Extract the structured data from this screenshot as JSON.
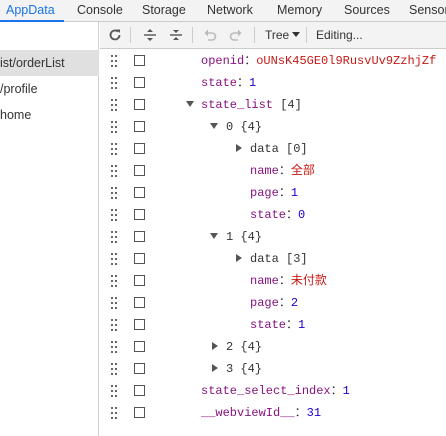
{
  "tabs": [
    "AppData",
    "Console",
    "Storage",
    "Network",
    "Memory",
    "Sources",
    "Sensor"
  ],
  "pages": [
    "ist/orderList",
    "/profile",
    "home"
  ],
  "toolbar": {
    "view_mode": "Tree",
    "editing_label": "Editing..."
  },
  "tree": {
    "openid": {
      "key": "openid",
      "value": "oUNsK45GE0l9RusvUv9ZzhjZf"
    },
    "state": {
      "key": "state",
      "value": "1"
    },
    "state_list": {
      "key": "state_list",
      "summary": "[4]"
    },
    "item0": {
      "key": "0",
      "summary": "{4}"
    },
    "item0_data": {
      "key": "data",
      "summary": "[0]"
    },
    "item0_name": {
      "key": "name",
      "value": "全部"
    },
    "item0_page": {
      "key": "page",
      "value": "1"
    },
    "item0_state": {
      "key": "state",
      "value": "0"
    },
    "item1": {
      "key": "1",
      "summary": "{4}"
    },
    "item1_data": {
      "key": "data",
      "summary": "[3]"
    },
    "item1_name": {
      "key": "name",
      "value": "未付款"
    },
    "item1_page": {
      "key": "page",
      "value": "2"
    },
    "item1_state": {
      "key": "state",
      "value": "1"
    },
    "item2": {
      "key": "2",
      "summary": "{4}"
    },
    "item3": {
      "key": "3",
      "summary": "{4}"
    },
    "state_select_index": {
      "key": "state_select_index",
      "value": "1"
    },
    "webviewId": {
      "key": "__webviewId__",
      "value": "31"
    }
  },
  "colors": {
    "accent": "#1a73e8",
    "key": "#881280",
    "number": "#1c00cf",
    "string": "#c41a16"
  },
  "icons": [
    "refresh-icon",
    "expand-all-icon",
    "collapse-all-icon",
    "undo-icon",
    "redo-icon",
    "drag-handle-icon",
    "checkbox-icon",
    "disclosure-triangle-icon"
  ]
}
